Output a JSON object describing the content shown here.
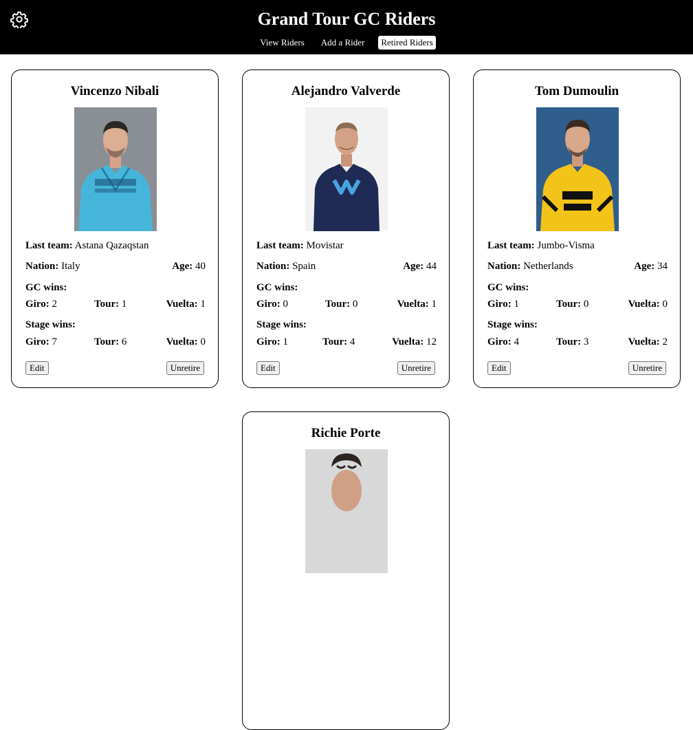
{
  "header": {
    "title": "Grand Tour GC Riders",
    "nav": [
      "View Riders",
      "Add a Rider",
      "Retired Riders"
    ],
    "active_nav": "Retired Riders"
  },
  "labels": {
    "last_team": "Last team:",
    "nation": "Nation:",
    "age": "Age:",
    "gc_wins": "GC wins:",
    "stage_wins": "Stage wins:",
    "giro": "Giro:",
    "tour": "Tour:",
    "vuelta": "Vuelta:",
    "edit": "Edit",
    "unretire": "Unretire"
  },
  "riders": [
    {
      "name": "Vincenzo Nibali",
      "last_team": "Astana Qazaqstan",
      "nation": "Italy",
      "age": "40",
      "gc": {
        "giro": "2",
        "tour": "1",
        "vuelta": "1"
      },
      "stages": {
        "giro": "7",
        "tour": "6",
        "vuelta": "0"
      },
      "jersey_color": "#45b6d9",
      "background_color": "#8a8f96"
    },
    {
      "name": "Alejandro Valverde",
      "last_team": "Movistar",
      "nation": "Spain",
      "age": "44",
      "gc": {
        "giro": "0",
        "tour": "0",
        "vuelta": "1"
      },
      "stages": {
        "giro": "1",
        "tour": "4",
        "vuelta": "12"
      },
      "jersey_color": "#1f2a55",
      "background_color": "#f2f2f2"
    },
    {
      "name": "Tom Dumoulin",
      "last_team": "Jumbo-Visma",
      "nation": "Netherlands",
      "age": "34",
      "gc": {
        "giro": "1",
        "tour": "0",
        "vuelta": "0"
      },
      "stages": {
        "giro": "4",
        "tour": "3",
        "vuelta": "2"
      },
      "jersey_color": "#f2c318",
      "background_color": "#2f5e8c"
    },
    {
      "name": "Richie Porte",
      "background_color": "#d8d8d8"
    }
  ]
}
